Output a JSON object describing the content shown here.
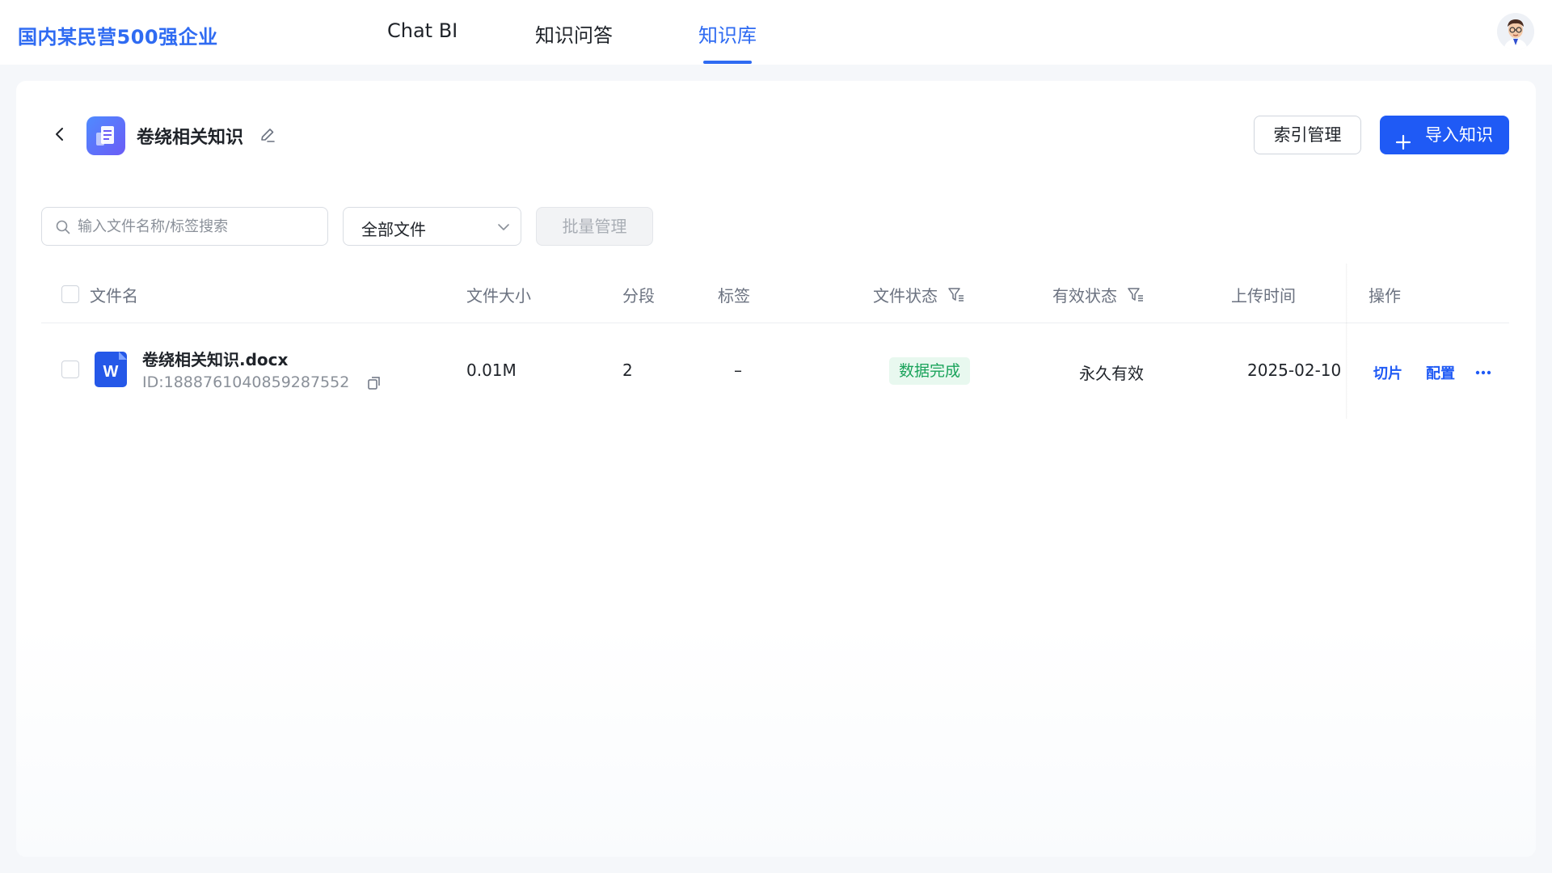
{
  "header": {
    "brand": "国内某民营500强企业",
    "tabs": [
      {
        "label": "Chat BI"
      },
      {
        "label": "知识问答"
      },
      {
        "label": "知识库"
      }
    ]
  },
  "kb": {
    "title": "卷绕相关知识",
    "index_button": "索引管理",
    "import_button": "导入知识"
  },
  "filters": {
    "search_placeholder": "输入文件名称/标签搜索",
    "file_type_selected": "全部文件",
    "batch_button": "批量管理"
  },
  "table": {
    "columns": [
      "文件名",
      "文件大小",
      "分段",
      "标签",
      "文件状态",
      "有效状态",
      "上传时间",
      "操作"
    ],
    "rows": [
      {
        "name": "卷绕相关知识.docx",
        "id": "ID:1888761040859287552",
        "size": "0.01M",
        "segments": "2",
        "tags": "–",
        "file_status": "数据完成",
        "validity": "永久有效",
        "upload_time": "2025-02-10",
        "actions": [
          "切片",
          "配置"
        ]
      }
    ]
  },
  "colors": {
    "accent": "#2f6bf2",
    "primary_button": "#1f5af5",
    "status_green": "#1aa35b",
    "status_green_bg": "#e8f8ef"
  },
  "icons": [
    "back-arrow-icon",
    "knowledge-base-icon",
    "edit-pencil-icon",
    "plus-icon",
    "search-icon",
    "chevron-down-icon",
    "filter-icon",
    "word-doc-icon",
    "copy-icon",
    "more-icon",
    "avatar"
  ]
}
